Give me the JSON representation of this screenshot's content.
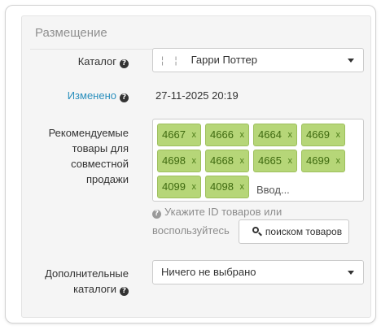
{
  "section": {
    "legend": "Размещение"
  },
  "catalog": {
    "label": "Каталог",
    "tree_marks": "¦ ¦",
    "value": "Гарри Поттер",
    "help_icon": "question-circle-icon",
    "caret_icon": "caret-down-icon"
  },
  "modified": {
    "label": "Изменено",
    "value": "27-11-2025 20:19",
    "help_icon": "question-circle-icon"
  },
  "recommended": {
    "label_lines": [
      "Рекомендуемые",
      "товары для",
      "совместной",
      "продажи"
    ],
    "tags": [
      "4667",
      "4666",
      "4664",
      "4669",
      "4698",
      "4668",
      "4665",
      "4699",
      "4099",
      "4098"
    ],
    "tag_remove": "x",
    "input_placeholder": "Ввод...",
    "help_line1": "Укажите ID товаров или",
    "help_line2": "воспользуйтесь",
    "search_button": "поиском товаров",
    "search_icon": "search-icon",
    "help_icon": "question-circle-icon",
    "tag_color": "#b6d678"
  },
  "extra_catalogs": {
    "label_lines": [
      "Дополнительные",
      "каталоги"
    ],
    "value": "Ничего не выбрано",
    "help_icon": "question-circle-icon",
    "caret_icon": "caret-down-icon"
  },
  "colors": {
    "link": "#2a8fbd",
    "panel_bg": "#f5f5f5",
    "tag_bg": "#b6d678",
    "tag_text": "#3f6a10"
  }
}
